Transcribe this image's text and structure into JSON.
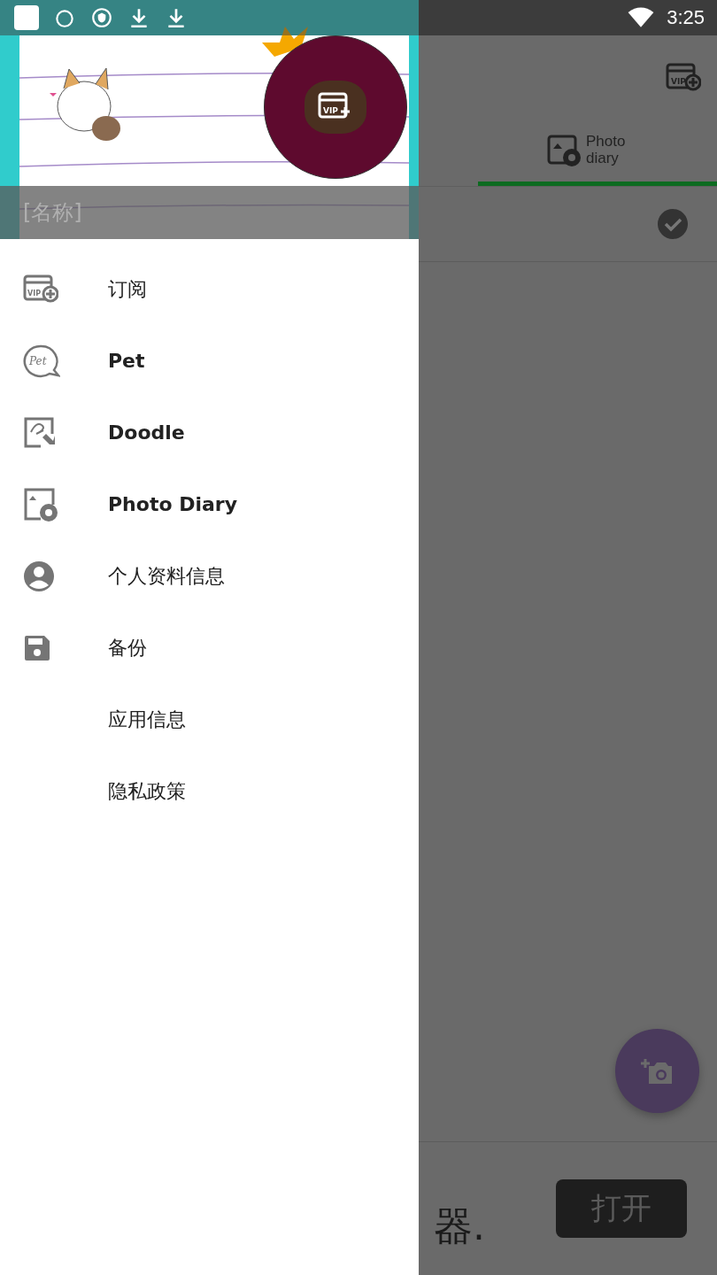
{
  "status_bar": {
    "time": "3:25"
  },
  "drawer": {
    "header": {
      "name": "[名称]",
      "badge_icon_text": "VIP"
    },
    "items": [
      {
        "label": "订阅",
        "kind": "vip",
        "icon_text": "VIP",
        "bold": false
      },
      {
        "label": "Pet",
        "kind": "pet",
        "icon_text": "Pet",
        "bold": true
      },
      {
        "label": "Doodle",
        "kind": "doodle",
        "bold": true
      },
      {
        "label": "Photo Diary",
        "kind": "photo",
        "bold": true
      },
      {
        "label": "个人资料信息",
        "kind": "person",
        "bold": false
      },
      {
        "label": "备份",
        "kind": "save",
        "bold": false
      },
      {
        "label": "应用信息",
        "kind": "none",
        "bold": false
      },
      {
        "label": "隐私政策",
        "kind": "none",
        "bold": false
      }
    ]
  },
  "app_bar": {
    "icon_text": "VIP",
    "tab": {
      "label": "Photo diary",
      "selected": true
    }
  },
  "row": {
    "checked": true
  },
  "banner": {
    "text": "器.",
    "button": "打开"
  }
}
